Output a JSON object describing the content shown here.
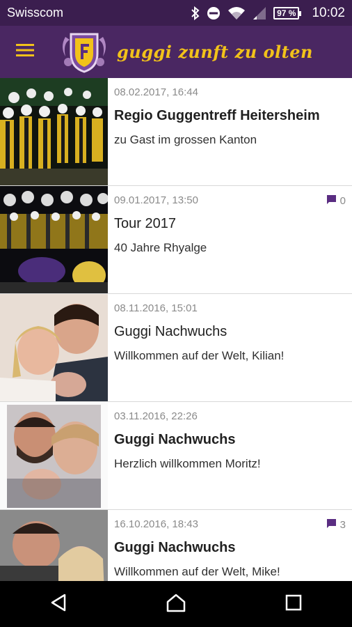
{
  "status_bar": {
    "carrier": "Swisscom",
    "battery": "97 %",
    "time": "10:02",
    "icons": [
      "bluetooth-icon",
      "do-not-disturb-icon",
      "wifi-icon",
      "signal-icon",
      "battery-icon"
    ]
  },
  "app_bar": {
    "title": "guggi zunft zu olten",
    "menu_icon": "hamburger-menu-icon",
    "logo": "guild-crest-logo"
  },
  "colors": {
    "status_bar": "#3b1e4f",
    "app_bar": "#4a2762",
    "title_gold": "#f2c21a",
    "comment_icon": "#5a2d82"
  },
  "news": [
    {
      "date": "08.02.2017, 16:44",
      "title": "Regio Guggentreff Heitersheim",
      "subtitle": "zu Gast im grossen Kanton",
      "bold": true,
      "comments": null
    },
    {
      "date": "09.01.2017, 13:50",
      "title": "Tour 2017",
      "subtitle": "40 Jahre Rhyalge",
      "bold": false,
      "comments": "0"
    },
    {
      "date": "08.11.2016, 15:01",
      "title": "Guggi Nachwuchs",
      "subtitle": "Willkommen auf der Welt, Kilian!",
      "bold": false,
      "comments": null
    },
    {
      "date": "03.11.2016, 22:26",
      "title": "Guggi Nachwuchs",
      "subtitle": "Herzlich willkommen Moritz!",
      "bold": true,
      "comments": null
    },
    {
      "date": "16.10.2016, 18:43",
      "title": "Guggi Nachwuchs",
      "subtitle": "Willkommen auf der Welt, Mike!",
      "bold": true,
      "comments": "3"
    }
  ],
  "nav_bar": {
    "icons": [
      "back-icon",
      "home-icon",
      "recents-icon"
    ]
  }
}
